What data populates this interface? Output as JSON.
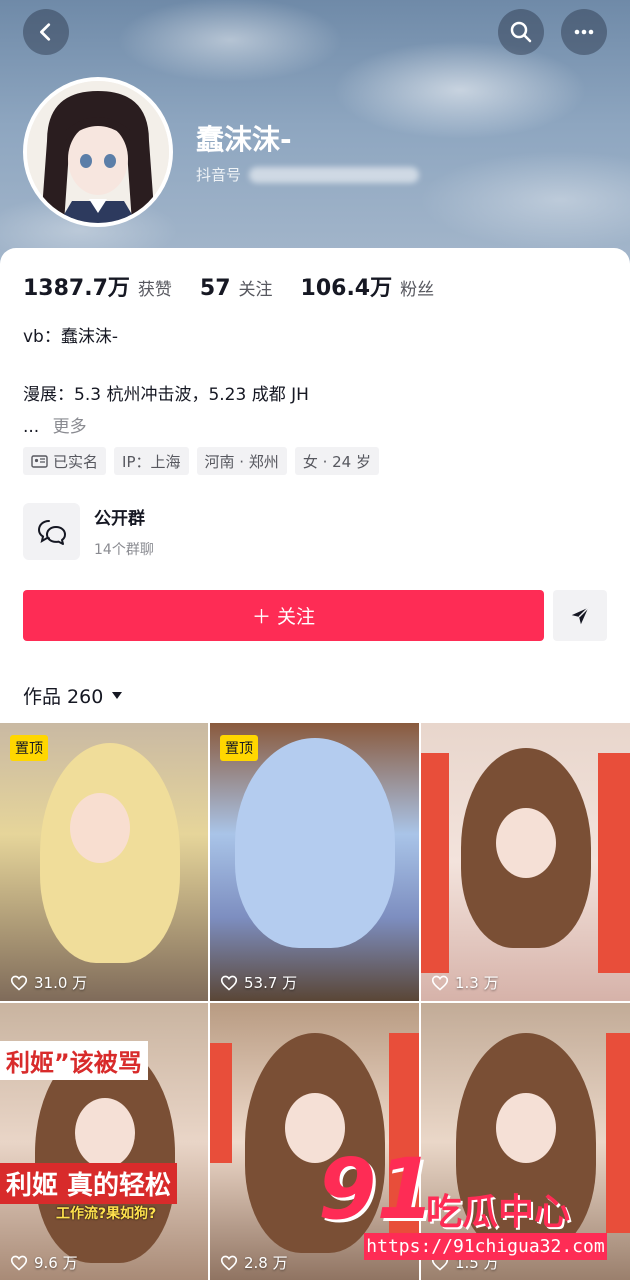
{
  "profile": {
    "nickname": "蠢沫沫-",
    "douyin_id_label": "抖音号"
  },
  "stats": [
    {
      "value": "1387.7万",
      "label": "获赞"
    },
    {
      "value": "57",
      "label": "关注"
    },
    {
      "value": "106.4万",
      "label": "粉丝"
    }
  ],
  "bio": {
    "line1": "vb：蠢沫沫-",
    "line2": "漫展：5.3 杭州冲击波，5.23 成都 JH",
    "ellipsis": "...",
    "more": "更多"
  },
  "tags": [
    "已实名",
    "IP：上海",
    "河南 · 郑州",
    "女 · 24 岁"
  ],
  "group": {
    "title": "公开群",
    "subtitle": "14个群聊"
  },
  "buttons": {
    "follow": "＋ 关注"
  },
  "works": {
    "label": "作品 260"
  },
  "grid": [
    {
      "pinned": "置顶",
      "likes": "31.0 万"
    },
    {
      "pinned": "置顶",
      "likes": "53.7 万"
    },
    {
      "pinned": "",
      "likes": "1.3 万"
    },
    {
      "pinned": "",
      "likes": "9.6 万",
      "overlay_top": "利姬”该被骂",
      "overlay_bottom": "利姬 真的轻松",
      "overlay_sub": "工作流?果如狗?"
    },
    {
      "pinned": "",
      "likes": "2.8 万"
    },
    {
      "pinned": "",
      "likes": "1.5 万"
    }
  ],
  "watermark": {
    "logo": "91",
    "text": "吃瓜中心",
    "url": "https://91chigua32.com"
  },
  "colors": {
    "accent": "#fe2c55",
    "pin": "#ffd700"
  }
}
